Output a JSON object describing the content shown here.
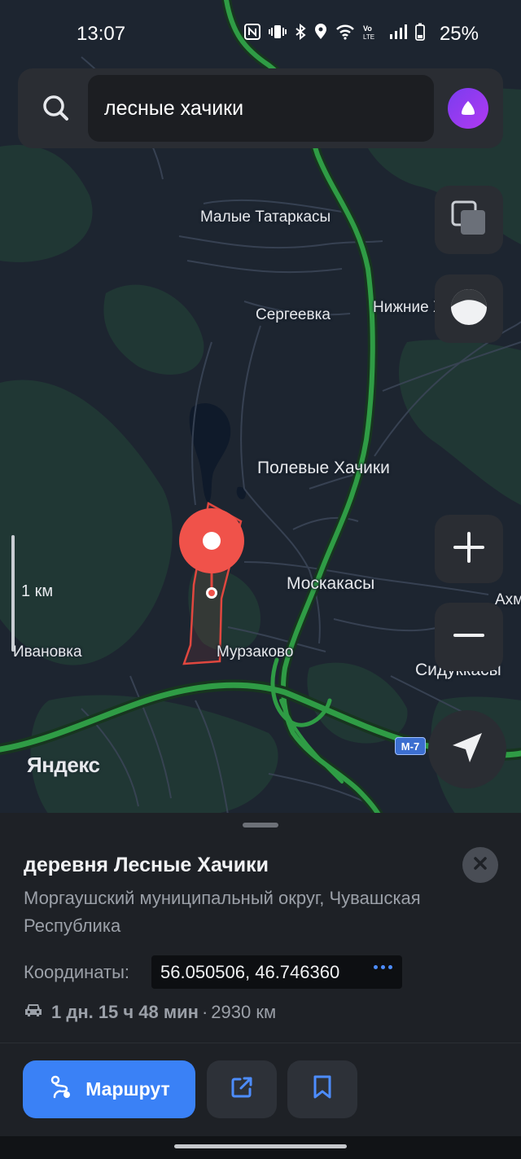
{
  "status_bar": {
    "time": "13:07",
    "battery": "25%",
    "icons": [
      "nfc-icon",
      "vibrate-icon",
      "bluetooth-icon",
      "location-icon",
      "wifi-icon",
      "volte-icon",
      "signal-icon",
      "battery-icon"
    ]
  },
  "search": {
    "query": "лесные хачики",
    "icons": [
      "search-icon",
      "alice-icon"
    ]
  },
  "map": {
    "labels": {
      "malye_tatarkasy": "Малые Татаркасы",
      "sergeevka": "Сергеевка",
      "nizhnie": "Нижние Х",
      "polevye_khachiki": "Полевые Хачики",
      "moskakasy": "Москакасы",
      "akhm": "Ахм",
      "murzakovo": "Мурзаково",
      "ivanovka": "Ивановка",
      "sidukkasy": "Сидуккасы"
    },
    "scale_label": "1 км",
    "road_badge": "M-7",
    "logo": "Яндекс",
    "controls": [
      "layers-icon",
      "night-mode-icon",
      "zoom-in-icon",
      "zoom-out-icon",
      "locate-icon"
    ],
    "colors": {
      "background": "#1d2530",
      "roads": "#2f9c45",
      "pin": "#f0524a"
    }
  },
  "place": {
    "title": "деревня Лесные Хачики",
    "address": "Моргаушский муниципальный округ, Чувашская Республика",
    "coordinates_label": "Координаты:",
    "coordinates": "56.050506, 46.746360",
    "travel_time": "1 дн. 15 ч 48 мин",
    "travel_sep": "·",
    "distance": "2930 км"
  },
  "actions": {
    "route_label": "Маршрут",
    "share_icon": "share-icon",
    "bookmark_icon": "bookmark-icon",
    "accent": "#3a81f6"
  }
}
